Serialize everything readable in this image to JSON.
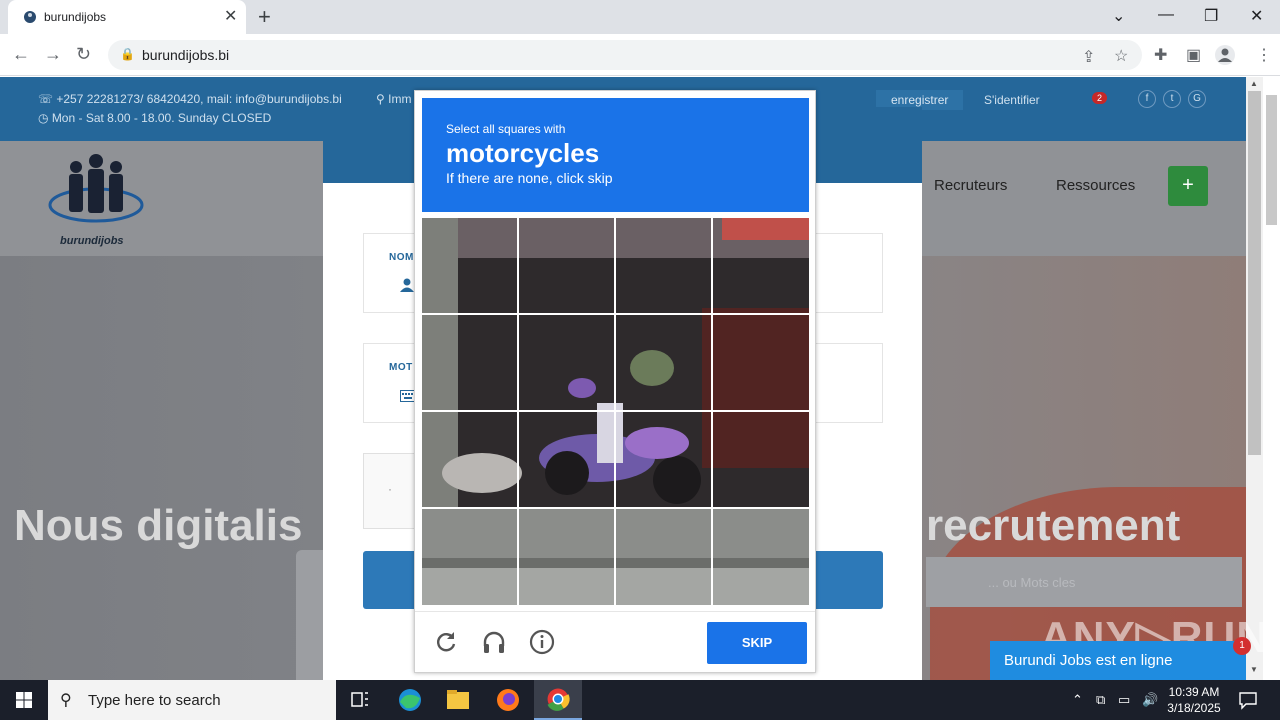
{
  "browser": {
    "tab_title": "burundijobs",
    "tab_close": "✕",
    "new_tab": "+",
    "url": "burundijobs.bi",
    "window_controls": {
      "dropdown": "⌄",
      "minimize": "—",
      "restore": "❐",
      "close": "✕"
    }
  },
  "topbar": {
    "contact_line1": "+257 22281273/ 68420420, mail: info@burundijobs.bi",
    "hours_line": "Mon - Sat 8.00 - 18.00. Sunday CLOSED",
    "address_fragment": "Imm",
    "register": "enregistrer",
    "login": "S'identifier",
    "notification_count": "2",
    "social": [
      "f",
      "t",
      "G"
    ]
  },
  "nav": {
    "logo_text": "burundijobs",
    "menu_recruteurs": "Recruteurs",
    "menu_ressources": "Ressources",
    "plus_button": "+"
  },
  "hero": {
    "headline_left": "Nous digitalis",
    "headline_right": "recrutement",
    "search_placeholder": "... ou Mots cles "
  },
  "login_form": {
    "name_label": "NOM",
    "password_label": "MOT",
    "captcha_dot": "·"
  },
  "captcha": {
    "instruction": "Select all squares with",
    "target": "motorcycles",
    "hint": "If there are none, click skip",
    "skip_label": "SKIP",
    "icons": [
      "reload-icon",
      "headphones-icon",
      "info-icon"
    ]
  },
  "watermark": "ANY▷RUN",
  "chat": {
    "label": "Burundi Jobs est en ligne",
    "badge": "1"
  },
  "taskbar": {
    "search_placeholder": "Type here to search",
    "time": "10:39 AM",
    "date": "3/18/2025"
  },
  "colors": {
    "site_blue": "#25679a",
    "captcha_blue": "#1a73e8",
    "green_button": "#2e8b3d",
    "chat_blue": "#1f8ce0"
  }
}
